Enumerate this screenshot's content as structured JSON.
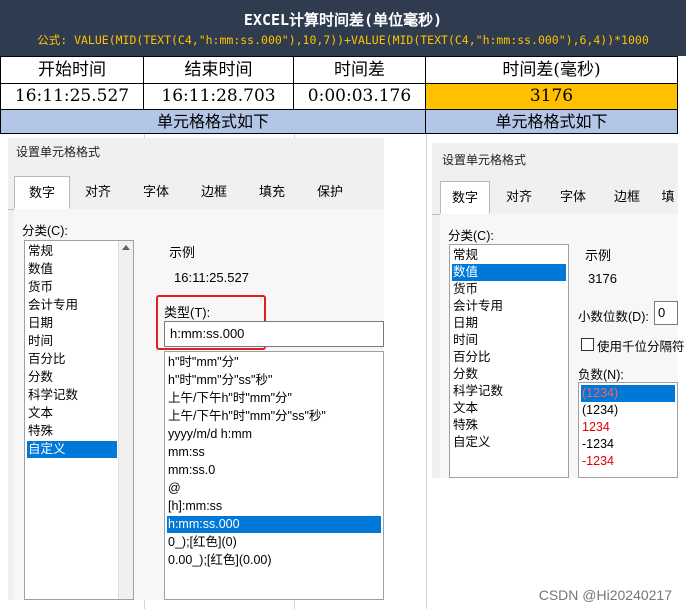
{
  "header": {
    "title": "EXCEL计算时间差(单位毫秒)",
    "formula": "公式: VALUE(MID(TEXT(C4,\"h:mm:ss.000\"),10,7))+VALUE(MID(TEXT(C4,\"h:mm:ss.000\"),6,4))*1000"
  },
  "table": {
    "headers": [
      "开始时间",
      "结束时间",
      "时间差",
      "时间差(毫秒)"
    ],
    "values": [
      "16:11:25.527",
      "16:11:28.703",
      "0:00:03.176",
      "3176"
    ],
    "format_note_left": "单元格格式如下",
    "format_note_right": "单元格格式如下",
    "highlight_color": "#ffc000",
    "note_color": "#b4c6e7"
  },
  "dialog_left": {
    "title": "设置单元格格式",
    "tabs": [
      "数字",
      "对齐",
      "字体",
      "边框",
      "填充",
      "保护"
    ],
    "category_label": "分类(C):",
    "categories": [
      "常规",
      "数值",
      "货币",
      "会计专用",
      "日期",
      "时间",
      "百分比",
      "分数",
      "科学记数",
      "文本",
      "特殊",
      "自定义"
    ],
    "selected_category": "自定义",
    "sample_label": "示例",
    "sample_value": "16:11:25.527",
    "type_label": "类型(T):",
    "type_value": "h:mm:ss.000",
    "formats": [
      "h\"时\"mm\"分\"",
      "h\"时\"mm\"分\"ss\"秒\"",
      "上午/下午h\"时\"mm\"分\"",
      "上午/下午h\"时\"mm\"分\"ss\"秒\"",
      "yyyy/m/d h:mm",
      "mm:ss",
      "mm:ss.0",
      "@",
      "[h]:mm:ss",
      "h:mm:ss.000",
      "0_);[红色](0)",
      "0.00_);[红色](0.00)"
    ],
    "selected_format": "h:mm:ss.000"
  },
  "dialog_right": {
    "title": "设置单元格格式",
    "tabs": [
      "数字",
      "对齐",
      "字体",
      "边框",
      "填"
    ],
    "category_label": "分类(C):",
    "categories": [
      "常规",
      "数值",
      "货币",
      "会计专用",
      "日期",
      "时间",
      "百分比",
      "分数",
      "科学记数",
      "文本",
      "特殊",
      "自定义"
    ],
    "selected_category": "数值",
    "sample_label": "示例",
    "sample_value": "3176",
    "decimal_label": "小数位数(D):",
    "decimal_value": "0",
    "thousands_label": "使用千位分隔符",
    "negative_label": "负数(N):",
    "negatives": [
      "(1234)",
      "(1234)",
      "1234",
      "-1234",
      "-1234"
    ]
  },
  "watermark": "CSDN @Hi20240217"
}
